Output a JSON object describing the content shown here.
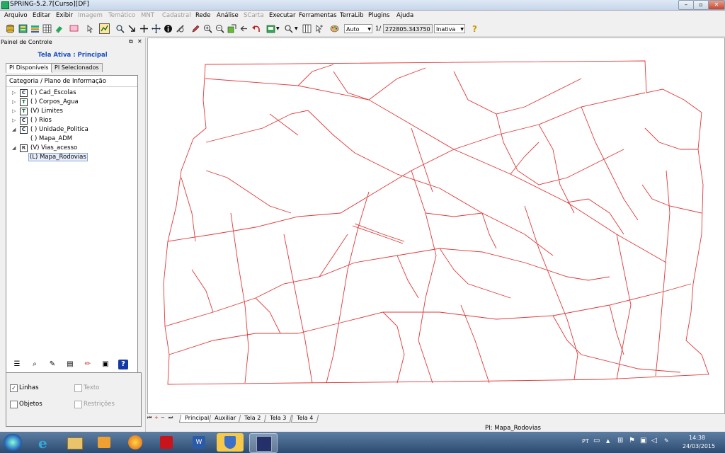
{
  "window": {
    "title": "SPRING-5.2.7[Curso][DF]",
    "min": "–",
    "max": "▫",
    "close": "✕"
  },
  "menubar": {
    "items": [
      {
        "label": "Arquivo",
        "enabled": true
      },
      {
        "label": "Editar",
        "enabled": true
      },
      {
        "label": "Exibir",
        "enabled": true
      },
      {
        "label": "Imagem",
        "enabled": false
      },
      {
        "label": "Temático",
        "enabled": false
      },
      {
        "label": "MNT",
        "enabled": false
      },
      {
        "label": "Cadastral",
        "enabled": false
      },
      {
        "label": "Rede",
        "enabled": true
      },
      {
        "label": "Análise",
        "enabled": true
      },
      {
        "label": "SCarta",
        "enabled": false
      },
      {
        "label": "Executar",
        "enabled": true
      },
      {
        "label": "Ferramentas",
        "enabled": true
      },
      {
        "label": "TerraLib",
        "enabled": true
      },
      {
        "label": "Plugins",
        "enabled": true
      },
      {
        "label": "Ajuda",
        "enabled": true
      }
    ]
  },
  "toolbar": {
    "scale_mode": "Auto",
    "scale_prefix": "1/",
    "scale_value": "272805.343750",
    "state": "Inativa"
  },
  "panel": {
    "title": "Painel de Controle",
    "active_screen": "Tela Ativa : Principal",
    "tabs": [
      "PI Disponíveis",
      "PI Selecionados"
    ],
    "tree_header": "Categoria / Plano de Informação",
    "nodes": [
      {
        "expander": "▷",
        "badge": "C",
        "label": "( ) Cad_Escolas"
      },
      {
        "expander": "▷",
        "badge": "T",
        "label": "( ) Corpos_Agua"
      },
      {
        "expander": "▷",
        "badge": "T",
        "label": "(V) Limites"
      },
      {
        "expander": "▷",
        "badge": "C",
        "label": "( ) Rios"
      },
      {
        "expander": "◢",
        "badge": "C",
        "label": "( ) Unidade_Politica"
      },
      {
        "expander": "",
        "badge": "",
        "label": "( ) Mapa_ADM"
      },
      {
        "expander": "◢",
        "badge": "R",
        "label": "(V) Vias_acesso"
      },
      {
        "expander": "",
        "badge": "",
        "label": "(L) Mapa_Rodovias"
      }
    ],
    "options": [
      {
        "label": "Linhas",
        "checked": true,
        "enabled": true
      },
      {
        "label": "Texto",
        "checked": false,
        "enabled": false
      },
      {
        "label": "Objetos",
        "checked": false,
        "enabled": true
      },
      {
        "label": "Restrições",
        "checked": false,
        "enabled": false
      }
    ]
  },
  "screen_tabs": [
    "Principal",
    "Auxiliar",
    "Tela 2",
    "Tela 3",
    "Tela 4"
  ],
  "status": "PI: Mapa_Rodovias",
  "taskbar": {
    "lang": "PT",
    "time": "14:38",
    "date": "24/03/2015"
  },
  "colors": {
    "road": "#e23838",
    "accent_blue": "#1a4fc0"
  }
}
